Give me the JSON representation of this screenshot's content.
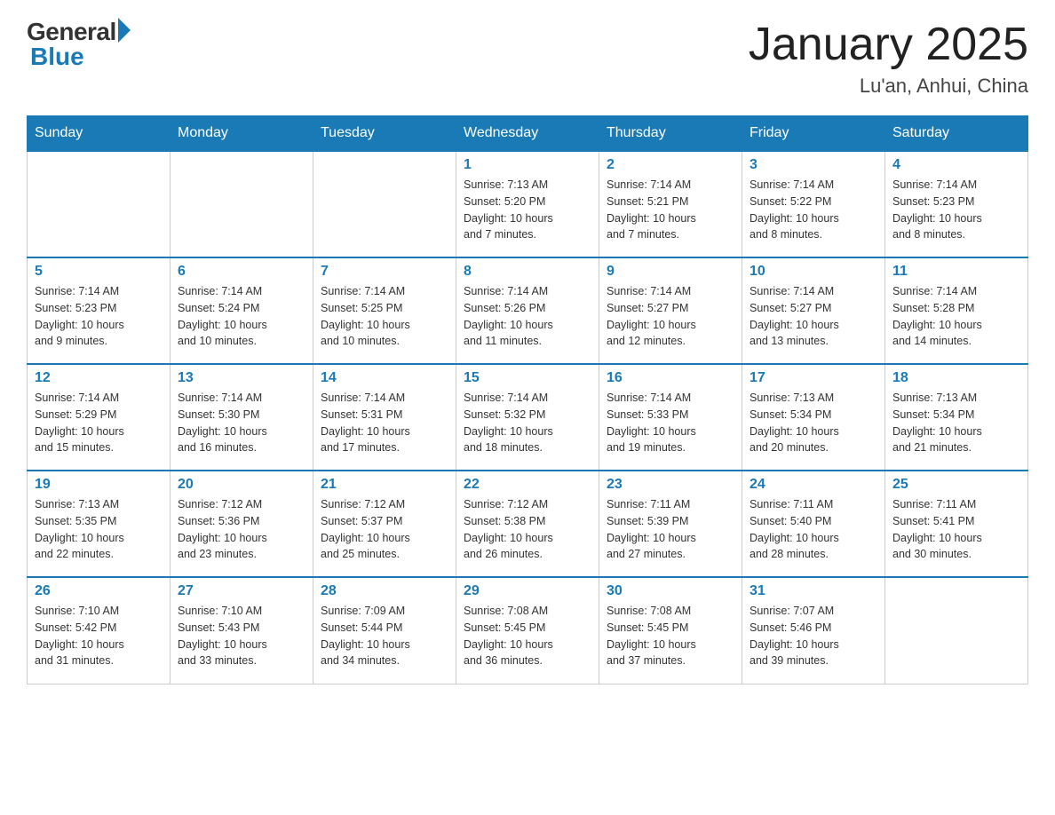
{
  "header": {
    "logo_general": "General",
    "logo_blue": "Blue",
    "month_year": "January 2025",
    "location": "Lu'an, Anhui, China"
  },
  "days_of_week": [
    "Sunday",
    "Monday",
    "Tuesday",
    "Wednesday",
    "Thursday",
    "Friday",
    "Saturday"
  ],
  "weeks": [
    [
      {
        "day": "",
        "info": ""
      },
      {
        "day": "",
        "info": ""
      },
      {
        "day": "",
        "info": ""
      },
      {
        "day": "1",
        "info": "Sunrise: 7:13 AM\nSunset: 5:20 PM\nDaylight: 10 hours\nand 7 minutes."
      },
      {
        "day": "2",
        "info": "Sunrise: 7:14 AM\nSunset: 5:21 PM\nDaylight: 10 hours\nand 7 minutes."
      },
      {
        "day": "3",
        "info": "Sunrise: 7:14 AM\nSunset: 5:22 PM\nDaylight: 10 hours\nand 8 minutes."
      },
      {
        "day": "4",
        "info": "Sunrise: 7:14 AM\nSunset: 5:23 PM\nDaylight: 10 hours\nand 8 minutes."
      }
    ],
    [
      {
        "day": "5",
        "info": "Sunrise: 7:14 AM\nSunset: 5:23 PM\nDaylight: 10 hours\nand 9 minutes."
      },
      {
        "day": "6",
        "info": "Sunrise: 7:14 AM\nSunset: 5:24 PM\nDaylight: 10 hours\nand 10 minutes."
      },
      {
        "day": "7",
        "info": "Sunrise: 7:14 AM\nSunset: 5:25 PM\nDaylight: 10 hours\nand 10 minutes."
      },
      {
        "day": "8",
        "info": "Sunrise: 7:14 AM\nSunset: 5:26 PM\nDaylight: 10 hours\nand 11 minutes."
      },
      {
        "day": "9",
        "info": "Sunrise: 7:14 AM\nSunset: 5:27 PM\nDaylight: 10 hours\nand 12 minutes."
      },
      {
        "day": "10",
        "info": "Sunrise: 7:14 AM\nSunset: 5:27 PM\nDaylight: 10 hours\nand 13 minutes."
      },
      {
        "day": "11",
        "info": "Sunrise: 7:14 AM\nSunset: 5:28 PM\nDaylight: 10 hours\nand 14 minutes."
      }
    ],
    [
      {
        "day": "12",
        "info": "Sunrise: 7:14 AM\nSunset: 5:29 PM\nDaylight: 10 hours\nand 15 minutes."
      },
      {
        "day": "13",
        "info": "Sunrise: 7:14 AM\nSunset: 5:30 PM\nDaylight: 10 hours\nand 16 minutes."
      },
      {
        "day": "14",
        "info": "Sunrise: 7:14 AM\nSunset: 5:31 PM\nDaylight: 10 hours\nand 17 minutes."
      },
      {
        "day": "15",
        "info": "Sunrise: 7:14 AM\nSunset: 5:32 PM\nDaylight: 10 hours\nand 18 minutes."
      },
      {
        "day": "16",
        "info": "Sunrise: 7:14 AM\nSunset: 5:33 PM\nDaylight: 10 hours\nand 19 minutes."
      },
      {
        "day": "17",
        "info": "Sunrise: 7:13 AM\nSunset: 5:34 PM\nDaylight: 10 hours\nand 20 minutes."
      },
      {
        "day": "18",
        "info": "Sunrise: 7:13 AM\nSunset: 5:34 PM\nDaylight: 10 hours\nand 21 minutes."
      }
    ],
    [
      {
        "day": "19",
        "info": "Sunrise: 7:13 AM\nSunset: 5:35 PM\nDaylight: 10 hours\nand 22 minutes."
      },
      {
        "day": "20",
        "info": "Sunrise: 7:12 AM\nSunset: 5:36 PM\nDaylight: 10 hours\nand 23 minutes."
      },
      {
        "day": "21",
        "info": "Sunrise: 7:12 AM\nSunset: 5:37 PM\nDaylight: 10 hours\nand 25 minutes."
      },
      {
        "day": "22",
        "info": "Sunrise: 7:12 AM\nSunset: 5:38 PM\nDaylight: 10 hours\nand 26 minutes."
      },
      {
        "day": "23",
        "info": "Sunrise: 7:11 AM\nSunset: 5:39 PM\nDaylight: 10 hours\nand 27 minutes."
      },
      {
        "day": "24",
        "info": "Sunrise: 7:11 AM\nSunset: 5:40 PM\nDaylight: 10 hours\nand 28 minutes."
      },
      {
        "day": "25",
        "info": "Sunrise: 7:11 AM\nSunset: 5:41 PM\nDaylight: 10 hours\nand 30 minutes."
      }
    ],
    [
      {
        "day": "26",
        "info": "Sunrise: 7:10 AM\nSunset: 5:42 PM\nDaylight: 10 hours\nand 31 minutes."
      },
      {
        "day": "27",
        "info": "Sunrise: 7:10 AM\nSunset: 5:43 PM\nDaylight: 10 hours\nand 33 minutes."
      },
      {
        "day": "28",
        "info": "Sunrise: 7:09 AM\nSunset: 5:44 PM\nDaylight: 10 hours\nand 34 minutes."
      },
      {
        "day": "29",
        "info": "Sunrise: 7:08 AM\nSunset: 5:45 PM\nDaylight: 10 hours\nand 36 minutes."
      },
      {
        "day": "30",
        "info": "Sunrise: 7:08 AM\nSunset: 5:45 PM\nDaylight: 10 hours\nand 37 minutes."
      },
      {
        "day": "31",
        "info": "Sunrise: 7:07 AM\nSunset: 5:46 PM\nDaylight: 10 hours\nand 39 minutes."
      },
      {
        "day": "",
        "info": ""
      }
    ]
  ]
}
